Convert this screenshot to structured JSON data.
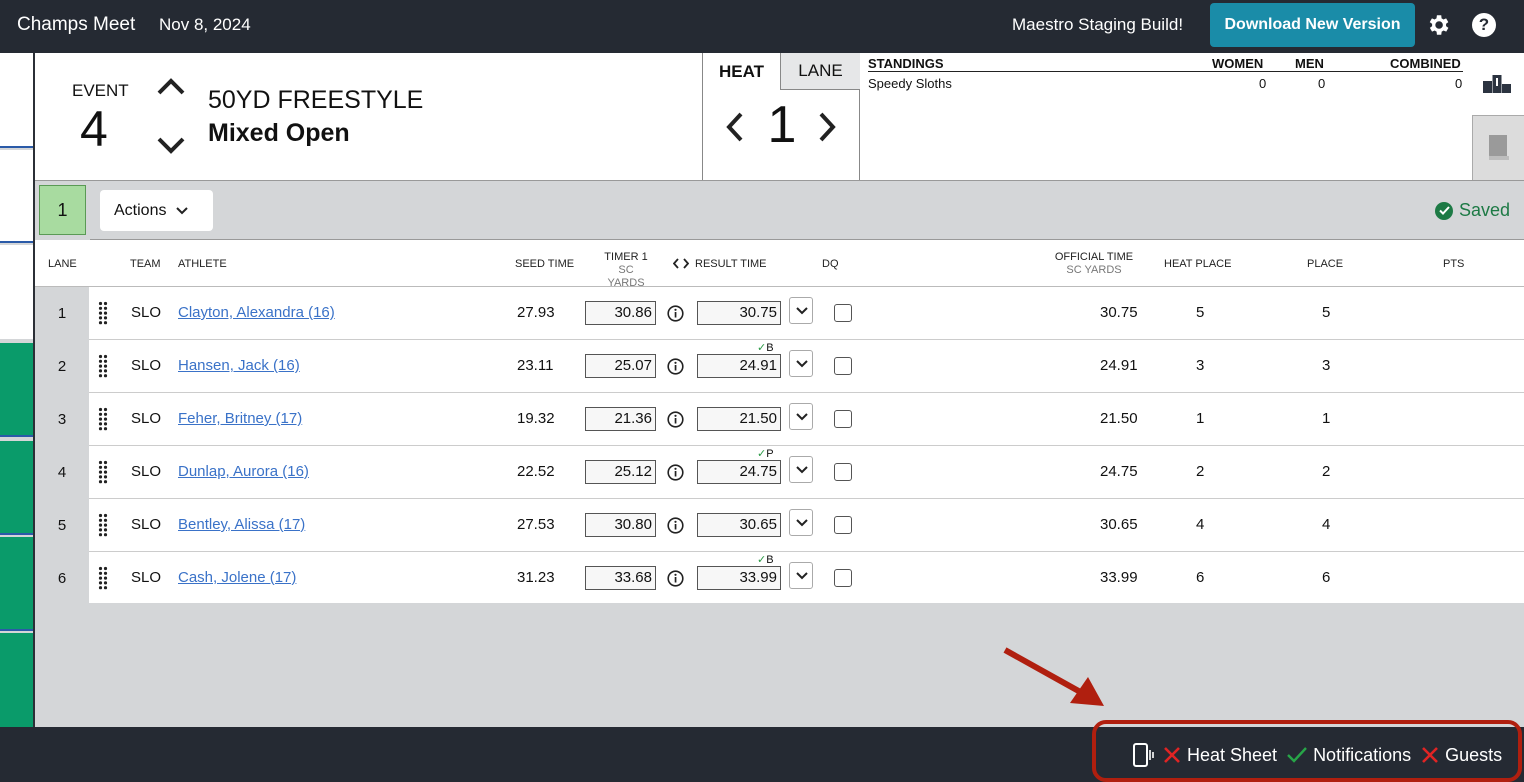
{
  "topbar": {
    "meet_name": "Champs Meet",
    "date": "Nov 8, 2024",
    "build_label": "Maestro Staging Build!",
    "download_label": "Download New Version",
    "help_label": "?"
  },
  "event": {
    "label": "EVENT",
    "number": "4",
    "name": "50YD FREESTYLE",
    "division": "Mixed Open"
  },
  "heat": {
    "tab_heat": "HEAT",
    "tab_lane": "LANE",
    "current": "1"
  },
  "standings": {
    "title": "STANDINGS",
    "col_women": "WOMEN",
    "col_men": "MEN",
    "col_combined": "COMBINED",
    "team": "Speedy Sloths",
    "women": "0",
    "men": "0",
    "combined": "0"
  },
  "toolbar": {
    "heat_chip": "1",
    "actions_label": "Actions",
    "saved_label": "Saved"
  },
  "table": {
    "headers": {
      "lane": "LANE",
      "team": "TEAM",
      "athlete": "ATHLETE",
      "seed_time": "SEED TIME",
      "timer1": "TIMER 1",
      "timer1_sub": "SC YARDS",
      "result_time": "RESULT TIME",
      "dq": "DQ",
      "official_time": "OFFICIAL TIME",
      "official_sub": "SC YARDS",
      "heat_place": "HEAT PLACE",
      "place": "PLACE",
      "pts": "PTS"
    },
    "rows": [
      {
        "lane": "1",
        "team": "SLO",
        "athlete": "Clayton, Alexandra (16)",
        "seed": "27.93",
        "timer1": "30.86",
        "result": "30.75",
        "flag": "",
        "official": "30.75",
        "heat_place": "5",
        "place": "5"
      },
      {
        "lane": "2",
        "team": "SLO",
        "athlete": "Hansen, Jack (16)",
        "seed": "23.11",
        "timer1": "25.07",
        "result": "24.91",
        "flag": "B",
        "official": "24.91",
        "heat_place": "3",
        "place": "3"
      },
      {
        "lane": "3",
        "team": "SLO",
        "athlete": "Feher, Britney (17)",
        "seed": "19.32",
        "timer1": "21.36",
        "result": "21.50",
        "flag": "",
        "official": "21.50",
        "heat_place": "1",
        "place": "1"
      },
      {
        "lane": "4",
        "team": "SLO",
        "athlete": "Dunlap, Aurora (16)",
        "seed": "22.52",
        "timer1": "25.12",
        "result": "24.75",
        "flag": "P",
        "official": "24.75",
        "heat_place": "2",
        "place": "2"
      },
      {
        "lane": "5",
        "team": "SLO",
        "athlete": "Bentley, Alissa (17)",
        "seed": "27.53",
        "timer1": "30.80",
        "result": "30.65",
        "flag": "",
        "official": "30.65",
        "heat_place": "4",
        "place": "4"
      },
      {
        "lane": "6",
        "team": "SLO",
        "athlete": "Cash, Jolene (17)",
        "seed": "31.23",
        "timer1": "33.68",
        "result": "33.99",
        "flag": "B",
        "official": "33.99",
        "heat_place": "6",
        "place": "6"
      }
    ]
  },
  "footer": {
    "heat_sheet_label": "Heat Sheet",
    "notifications_label": "Notifications",
    "guests_label": "Guests"
  },
  "colors": {
    "topbar_bg": "#252a33",
    "accent_button": "#1a8ca8",
    "saved_green": "#1d7a45",
    "heat_chip_green": "#a8dba0",
    "sidebar_green": "#0a9b6a",
    "link_blue": "#3a72c8",
    "annotation_red": "#b01f0f"
  }
}
